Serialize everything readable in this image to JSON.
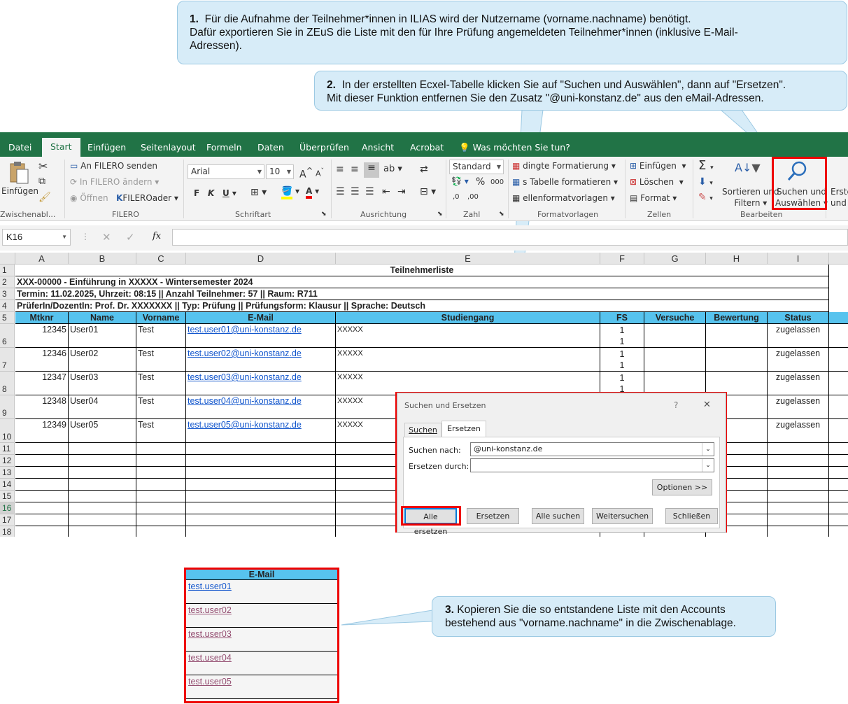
{
  "callouts": {
    "c1_num": "1.",
    "c1_line1": "Für die Aufnahme der Teilnehmer*innen in ILIAS wird der Nutzername (vorname.nachname) benötigt.",
    "c1_line2": "Dafür exportieren Sie in ZEuS die Liste mit den für Ihre Prüfung angemeldeten Teilnehmer*innen (inklusive E-Mail-",
    "c1_line3": "Adressen).",
    "c2_num": "2.",
    "c2_line1": "In der erstellten Ecxel-Tabelle klicken Sie auf \"Suchen und Auswählen\", dann auf \"Ersetzen\".",
    "c2_line2": "Mit dieser Funktion entfernen Sie den Zusatz \"@uni-konstanz.de\" aus den eMail-Adressen.",
    "c3_num": "3.",
    "c3_line1": "Kopieren Sie die so entstandene Liste mit den Accounts",
    "c3_line2": "bestehend aus \"vorname.nachname\" in die Zwischenablage."
  },
  "ribbon_tabs": [
    "Datei",
    "Start",
    "Einfügen",
    "Seitenlayout",
    "Formeln",
    "Daten",
    "Überprüfen",
    "Ansicht",
    "Acrobat",
    "Was möchten Sie tun?"
  ],
  "ribbon": {
    "clipboard": {
      "paste": "Einfügen",
      "label": "Zwischenabl..."
    },
    "filero": {
      "send": "An FILERO senden",
      "change": "In FILERO ändern",
      "open": "Öffnen",
      "fileroader": "FILEROader",
      "label": "FILERO"
    },
    "font": {
      "name": "Arial",
      "size": "10",
      "bold": "F",
      "italic": "K",
      "underline": "U",
      "grow": "A",
      "shrink": "A",
      "color_letter": "A",
      "label": "Schriftart"
    },
    "alignment": {
      "label": "Ausrichtung"
    },
    "number": {
      "format": "Standard",
      "percent": "%",
      "thousands": "000",
      "inc": ",0",
      "dec": ",00",
      "label": "Zahl"
    },
    "styles": {
      "cond": "dingte Formatierung",
      "table": "s Tabelle formatieren",
      "cell": "ellenformatvorlagen",
      "label": "Formatvorlagen"
    },
    "cells": {
      "insert": "Einfügen",
      "delete": "Löschen",
      "format": "Format",
      "label": "Zellen"
    },
    "editing": {
      "sort1": "Sortieren und",
      "sort2": "Filtern",
      "find1": "Suchen und",
      "find2": "Auswählen",
      "label": "Bearbeiten"
    },
    "create": {
      "l1": "Erste",
      "l2": "und"
    }
  },
  "formula_bar": {
    "namebox": "K16",
    "fx": "fx"
  },
  "sheet": {
    "columns": [
      "A",
      "B",
      "C",
      "D",
      "E",
      "F",
      "G",
      "H",
      "I"
    ],
    "row_numbers": [
      "1",
      "2",
      "3",
      "4",
      "5",
      "6",
      "7",
      "8",
      "9",
      "10",
      "11",
      "12",
      "13",
      "14",
      "15",
      "16",
      "17",
      "18"
    ],
    "title": "Teilnehmerliste",
    "row2": "XXX-00000 - Einführung in XXXXX   -   Wintersemester 2024",
    "row3": "Termin: 11.02.2025, Uhrzeit: 08:15 || Anzahl Teilnehmer: 57 || Raum: R711",
    "row4": "PrüferIn/DozentIn: Prof. Dr. XXXXXXX  || Typ: Prüfung || Prüfungsform: Klausur || Sprache: Deutsch",
    "headers": [
      "Mtknr",
      "Name",
      "Vorname",
      "E-Mail",
      "Studiengang",
      "FS",
      "Versuche",
      "Bewertung",
      "Status"
    ],
    "rows": [
      {
        "mtknr": "12345",
        "name": "User01",
        "vorname": "Test",
        "email": "test.user01@uni-konstanz.de",
        "studiengang": "XXXXX",
        "fs1": "1",
        "fs2": "1",
        "status": "zugelassen"
      },
      {
        "mtknr": "12346",
        "name": "User02",
        "vorname": "Test",
        "email": "test.user02@uni-konstanz.de",
        "studiengang": "XXXXX",
        "fs1": "1",
        "fs2": "1",
        "status": "zugelassen"
      },
      {
        "mtknr": "12347",
        "name": "User03",
        "vorname": "Test",
        "email": "test.user03@uni-konstanz.de",
        "studiengang": "XXXXX",
        "fs1": "1",
        "fs2": "1",
        "status": "zugelassen"
      },
      {
        "mtknr": "12348",
        "name": "User04",
        "vorname": "Test",
        "email": "test.user04@uni-konstanz.de",
        "studiengang": "XXXXX",
        "fs1": "",
        "fs2": "",
        "status": "zugelassen"
      },
      {
        "mtknr": "12349",
        "name": "User05",
        "vorname": "Test",
        "email": "test.user05@uni-konstanz.de",
        "studiengang": "XXXXX",
        "fs1": "",
        "fs2": "",
        "status": "zugelassen"
      }
    ]
  },
  "dialog": {
    "title": "Suchen und Ersetzen",
    "help": "?",
    "close": "✕",
    "tab_find": "Suchen",
    "tab_replace": "Ersetzen",
    "find_label": "Suchen nach:",
    "find_value": "@uni-konstanz.de",
    "replace_label": "Ersetzen durch:",
    "replace_value": "",
    "options": "Optionen >>",
    "replace_all": "Alle ersetzen",
    "replace": "Ersetzen",
    "find_all": "Alle suchen",
    "find_next": "Weitersuchen",
    "close_btn": "Schließen"
  },
  "result_list": {
    "header": "E-Mail",
    "items": [
      "test.user01",
      "test.user02",
      "test.user03",
      "test.user04",
      "test.user05"
    ]
  },
  "colors": {
    "excel_green": "#217346",
    "header_blue": "#57c3ee",
    "callout_bg": "#d7ecf8",
    "highlight_red": "#e00000"
  }
}
